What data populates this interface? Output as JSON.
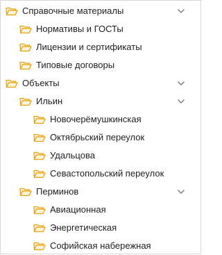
{
  "tree": {
    "items": [
      {
        "label": "Справочные материалы",
        "expanded": true
      },
      {
        "label": "Нормативы и ГОСТы"
      },
      {
        "label": "Лицензии и сертификаты"
      },
      {
        "label": "Типовые договоры"
      },
      {
        "label": "Объекты",
        "expanded": true
      },
      {
        "label": "Ильин",
        "expanded": true
      },
      {
        "label": "Новочерёмушкинская"
      },
      {
        "label": "Октябрьский переулок"
      },
      {
        "label": "Удальцова"
      },
      {
        "label": "Севастопольский переулок"
      },
      {
        "label": "Перминов",
        "expanded": true
      },
      {
        "label": "Авиационная"
      },
      {
        "label": "Энергетическая"
      },
      {
        "label": "Софийская набережная"
      }
    ]
  },
  "colors": {
    "folder_stroke": "#e8a316",
    "folder_fill": "#fff4d6",
    "chevron": "#7a7a7a",
    "border": "#d7d7d7"
  },
  "icons": {
    "folder": "folder-open-icon",
    "chevron": "chevron-down-icon"
  }
}
